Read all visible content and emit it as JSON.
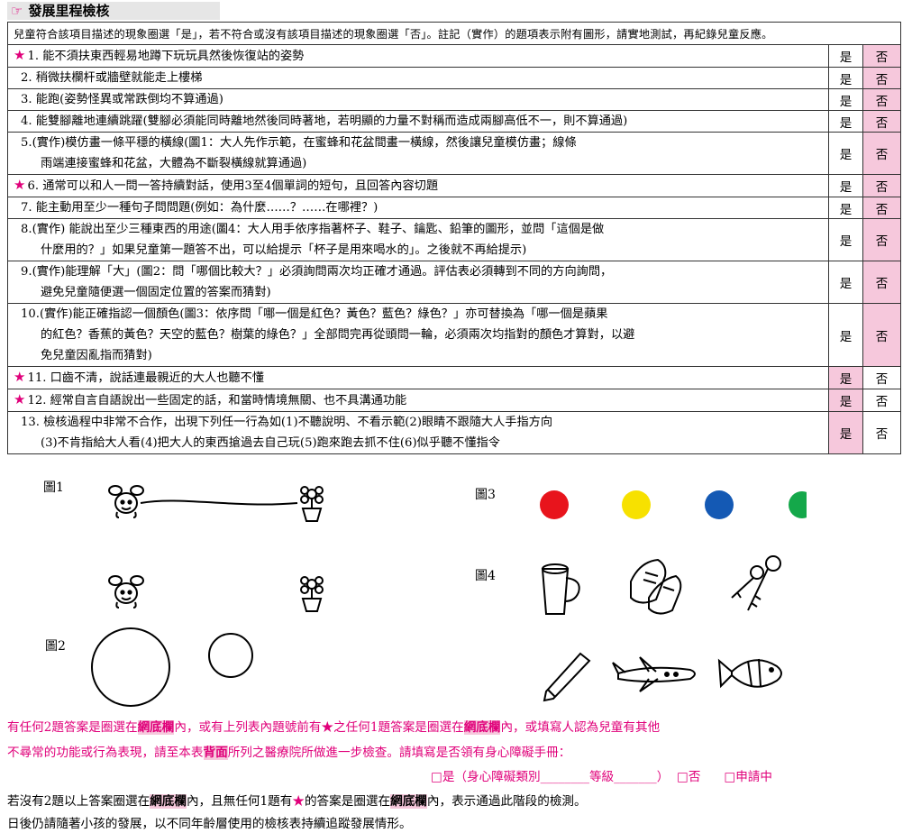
{
  "title": "發展里程檢核",
  "intro": "兒童符合該項目描述的現象圈選「是」，若不符合或沒有該項目描述的現象圈選「否」。註記（實作）的題項表示附有圖形，請實地測試，再紀錄兒童反應。",
  "yes_label": "是",
  "no_label": "否",
  "items": [
    {
      "lines": [
        "1. 能不須扶東西輕易地蹲下玩玩具然後恢復站的姿勢"
      ],
      "star": true,
      "pink": "no"
    },
    {
      "lines": [
        "2. 稍微扶欄杆或牆壁就能走上樓梯"
      ],
      "star": false,
      "pink": "no"
    },
    {
      "lines": [
        "3. 能跑(姿勢怪異或常跌倒均不算通過)"
      ],
      "star": false,
      "pink": "no"
    },
    {
      "lines": [
        "4. 能雙腳離地連續跳躍(雙腳必須能同時離地然後同時著地，若明顯的力量不對稱而造成兩腳高低不一，則不算通過)"
      ],
      "star": false,
      "pink": "no"
    },
    {
      "lines": [
        "5.(實作)模仿畫一條平穩的橫線(圖1：大人先作示範，在蜜蜂和花盆間畫一橫線，然後讓兒童模仿畫；線條",
        "雨端連接蜜蜂和花盆，大體為不斷裂橫線就算通過)"
      ],
      "star": false,
      "pink": "no"
    },
    {
      "lines": [
        "6. 通常可以和人一問一答持續對話，使用3至4個單詞的短句，且回答內容切題"
      ],
      "star": true,
      "pink": "no"
    },
    {
      "lines": [
        "7. 能主動用至少一種句子問問題(例如：為什麼……？……在哪裡？)"
      ],
      "star": false,
      "pink": "no"
    },
    {
      "lines": [
        "8.(實作) 能說出至少三種東西的用途(圖4：大人用手依序指著杯子、鞋子、鑰匙、鉛筆的圖形，並問「這個是做",
        "什麼用的？」如果兒童第一題答不出，可以給提示「杯子是用來喝水的」。之後就不再給提示)"
      ],
      "star": false,
      "pink": "no"
    },
    {
      "lines": [
        "9.(實作)能理解「大」(圖2：問「哪個比較大？」必須詢問兩次均正確才通過。評估表必須轉到不同的方向詢問，",
        "避免兒童隨便選一個固定位置的答案而猜對)"
      ],
      "star": false,
      "pink": "no"
    },
    {
      "lines": [
        "10.(實作)能正確指認一個顏色(圖3：依序問「哪一個是紅色？黃色？藍色？綠色？」亦可替換為「哪一個是蘋果",
        "的紅色？香蕉的黃色？天空的藍色？樹葉的綠色？」全部問完再從頭問一輪，必須兩次均指對的顏色才算對，以避",
        "免兒童因亂指而猜對)"
      ],
      "star": false,
      "pink": "no"
    },
    {
      "lines": [
        "11. 口齒不清，說話連最親近的大人也聽不懂"
      ],
      "star": true,
      "pink": "yes"
    },
    {
      "lines": [
        "12. 經常自言自語說出一些固定的話，和當時情境無關、也不具溝通功能"
      ],
      "star": true,
      "pink": "yes"
    },
    {
      "lines": [
        "13. 檢核過程中非常不合作，出現下列任一行為如(1)不聽說明、不看示範(2)眼睛不跟隨大人手指方向",
        "(3)不肯指給大人看(4)把大人的東西搶過去自己玩(5)跑來跑去抓不住(6)似乎聽不懂指令"
      ],
      "star": false,
      "pink": "yes"
    }
  ],
  "figures": {
    "fig1": "圖1",
    "fig2": "圖2",
    "fig3": "圖3",
    "fig4": "圖4"
  },
  "colors": {
    "accent": "#e0007a",
    "pink_bg": "#f6c8dc",
    "red": "#e8141c",
    "yellow": "#f7e100",
    "blue": "#1459b4",
    "green": "#14a84a"
  },
  "notes": {
    "p1_a": "有任何2題答案是圈選在",
    "net": "網底欄",
    "p1_b": "內，或有上列表內題號前有",
    "p1_c": "之任何1題答案是圈選在",
    "p1_d": "內，或填寫人認為兒童有其他",
    "p2_a": "不尋常的功能或行為表現，請至本表",
    "back": "背面",
    "p2_b": "所列之醫療院所做進一步檢查。請填寫是否領有身心障礙手冊：",
    "opt_yes": "□是（身心障礙類別________等級_______）",
    "opt_no": "□否",
    "opt_apply": "□申請中",
    "p3_a": "若沒有2題以上答案圈選在",
    "p3_b": "內，且無任何1題有",
    "p3_c": "的答案是圈選在",
    "p3_d": "內，表示通過此階段的檢測。",
    "p4": "日後仍請隨著小孩的發展，以不同年齡層使用的檢核表持續追蹤發展情形。"
  }
}
